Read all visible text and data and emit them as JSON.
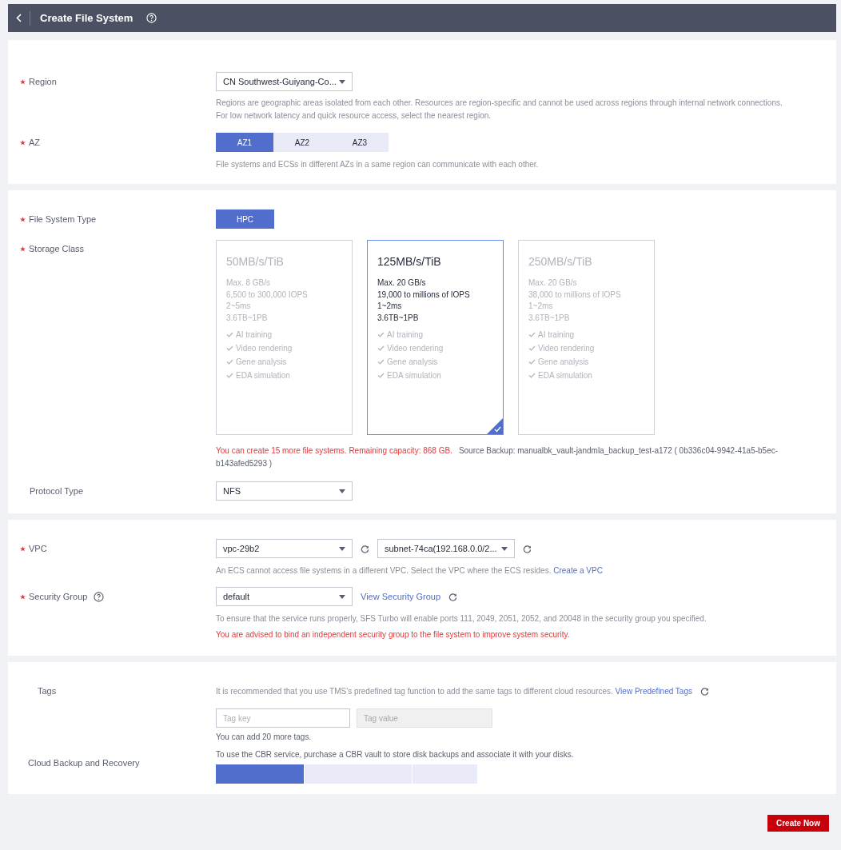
{
  "header": {
    "title": "Create File System"
  },
  "region": {
    "label": "Region",
    "required": true,
    "value": "CN Southwest-Guiyang-Co...",
    "hint": [
      "Regions are geographic areas isolated from each other. Resources are region-specific and cannot be used across regions through internal network connections.",
      "For low network latency and quick resource access, select the nearest region."
    ]
  },
  "az": {
    "label": "AZ",
    "required": true,
    "options": [
      {
        "label": "AZ1",
        "selected": true
      },
      {
        "label": "AZ2",
        "selected": false
      },
      {
        "label": "AZ3",
        "selected": false
      }
    ],
    "hint": "File systems and ECSs in different AZs in a same region can communicate with each other."
  },
  "file_system_type": {
    "label": "File System Type",
    "required": true,
    "options": [
      {
        "label": "HPC",
        "selected": true
      }
    ]
  },
  "storage_class": {
    "label": "Storage Class",
    "required": true,
    "cards": [
      {
        "title": "50MB/s/TiB",
        "selected": false,
        "specs": [
          "Max. 8 GB/s",
          "6,500 to 300,000 IOPS",
          "2~5ms",
          "3.6TB~1PB"
        ],
        "features": [
          "AI training",
          "Video rendering",
          "Gene analysis",
          "EDA simulation"
        ]
      },
      {
        "title": "125MB/s/TiB",
        "selected": true,
        "specs": [
          "Max. 20 GB/s",
          "19,000 to millions of IOPS",
          "1~2ms",
          "3.6TB~1PB"
        ],
        "features": [
          "AI training",
          "Video rendering",
          "Gene analysis",
          "EDA simulation"
        ]
      },
      {
        "title": "250MB/s/TiB",
        "selected": false,
        "specs": [
          "Max. 20 GB/s",
          "38,000 to millions of IOPS",
          "1~2ms",
          "3.6TB~1PB"
        ],
        "features": [
          "AI training",
          "Video rendering",
          "Gene analysis",
          "EDA simulation"
        ]
      }
    ],
    "capacity_notice": "You can create 15 more file systems. Remaining capacity: 868 GB.",
    "source_backup": "Source Backup: manualbk_vault-jandmla_backup_test-a172 ( 0b336c04-9942-41a5-b5ec-b143afed5293 )"
  },
  "protocol_type": {
    "label": "Protocol Type",
    "required": false,
    "value": "NFS"
  },
  "vpc": {
    "label": "VPC",
    "required": true,
    "value": "vpc-29b2",
    "subnet": "subnet-74ca(192.168.0.0/2...",
    "hint": "An ECS cannot access file systems in a different VPC. Select the VPC where the ECS resides.",
    "link": "Create a VPC"
  },
  "security_group": {
    "label": "Security Group",
    "required": true,
    "value": "default",
    "link": "View Security Group",
    "hint": "To ensure that the service runs properly, SFS Turbo will enable ports 111, 2049, 2051, 2052, and 20048 in the security group you specified.",
    "warning": "You are advised to bind an independent security group to the file system to improve system security."
  },
  "tags": {
    "label": "Tags",
    "required": false,
    "hint": "It is recommended that you use TMS's predefined tag function to add the same tags to different cloud resources.",
    "link": "View Predefined Tags",
    "key_placeholder": "Tag key",
    "value_placeholder": "Tag value",
    "value_disabled": true,
    "note": "You can add 20 more tags."
  },
  "cloud_backup": {
    "label": "Cloud Backup and Recovery",
    "required": false,
    "hint": "To use the CBR service, purchase a CBR vault to store disk backups and associate it with your disks.",
    "tabs": [
      {
        "selected": true
      },
      {
        "selected": false
      },
      {
        "selected": false
      }
    ]
  },
  "create_button": "Create Now"
}
